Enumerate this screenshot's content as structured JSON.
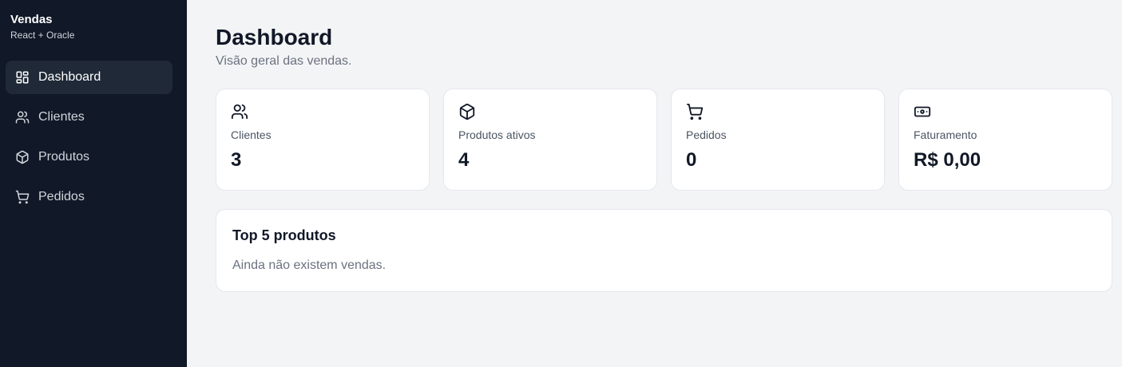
{
  "brand": {
    "title": "Vendas",
    "subtitle": "React + Oracle"
  },
  "sidebar": {
    "items": [
      {
        "label": "Dashboard",
        "icon": "dashboard-icon",
        "active": true
      },
      {
        "label": "Clientes",
        "icon": "users-icon",
        "active": false
      },
      {
        "label": "Produtos",
        "icon": "box-icon",
        "active": false
      },
      {
        "label": "Pedidos",
        "icon": "cart-icon",
        "active": false
      }
    ]
  },
  "header": {
    "title": "Dashboard",
    "subtitle": "Visão geral das vendas."
  },
  "stats": [
    {
      "label": "Clientes",
      "value": "3",
      "icon": "users-icon"
    },
    {
      "label": "Produtos ativos",
      "value": "4",
      "icon": "box-icon"
    },
    {
      "label": "Pedidos",
      "value": "0",
      "icon": "cart-icon"
    },
    {
      "label": "Faturamento",
      "value": "R$ 0,00",
      "icon": "money-icon"
    }
  ],
  "top_products": {
    "title": "Top 5 produtos",
    "empty_message": "Ainda não existem vendas."
  },
  "colors": {
    "sidebar_bg": "#111827",
    "page_bg": "#f3f4f6",
    "active_item_bg": "#1f2937"
  }
}
